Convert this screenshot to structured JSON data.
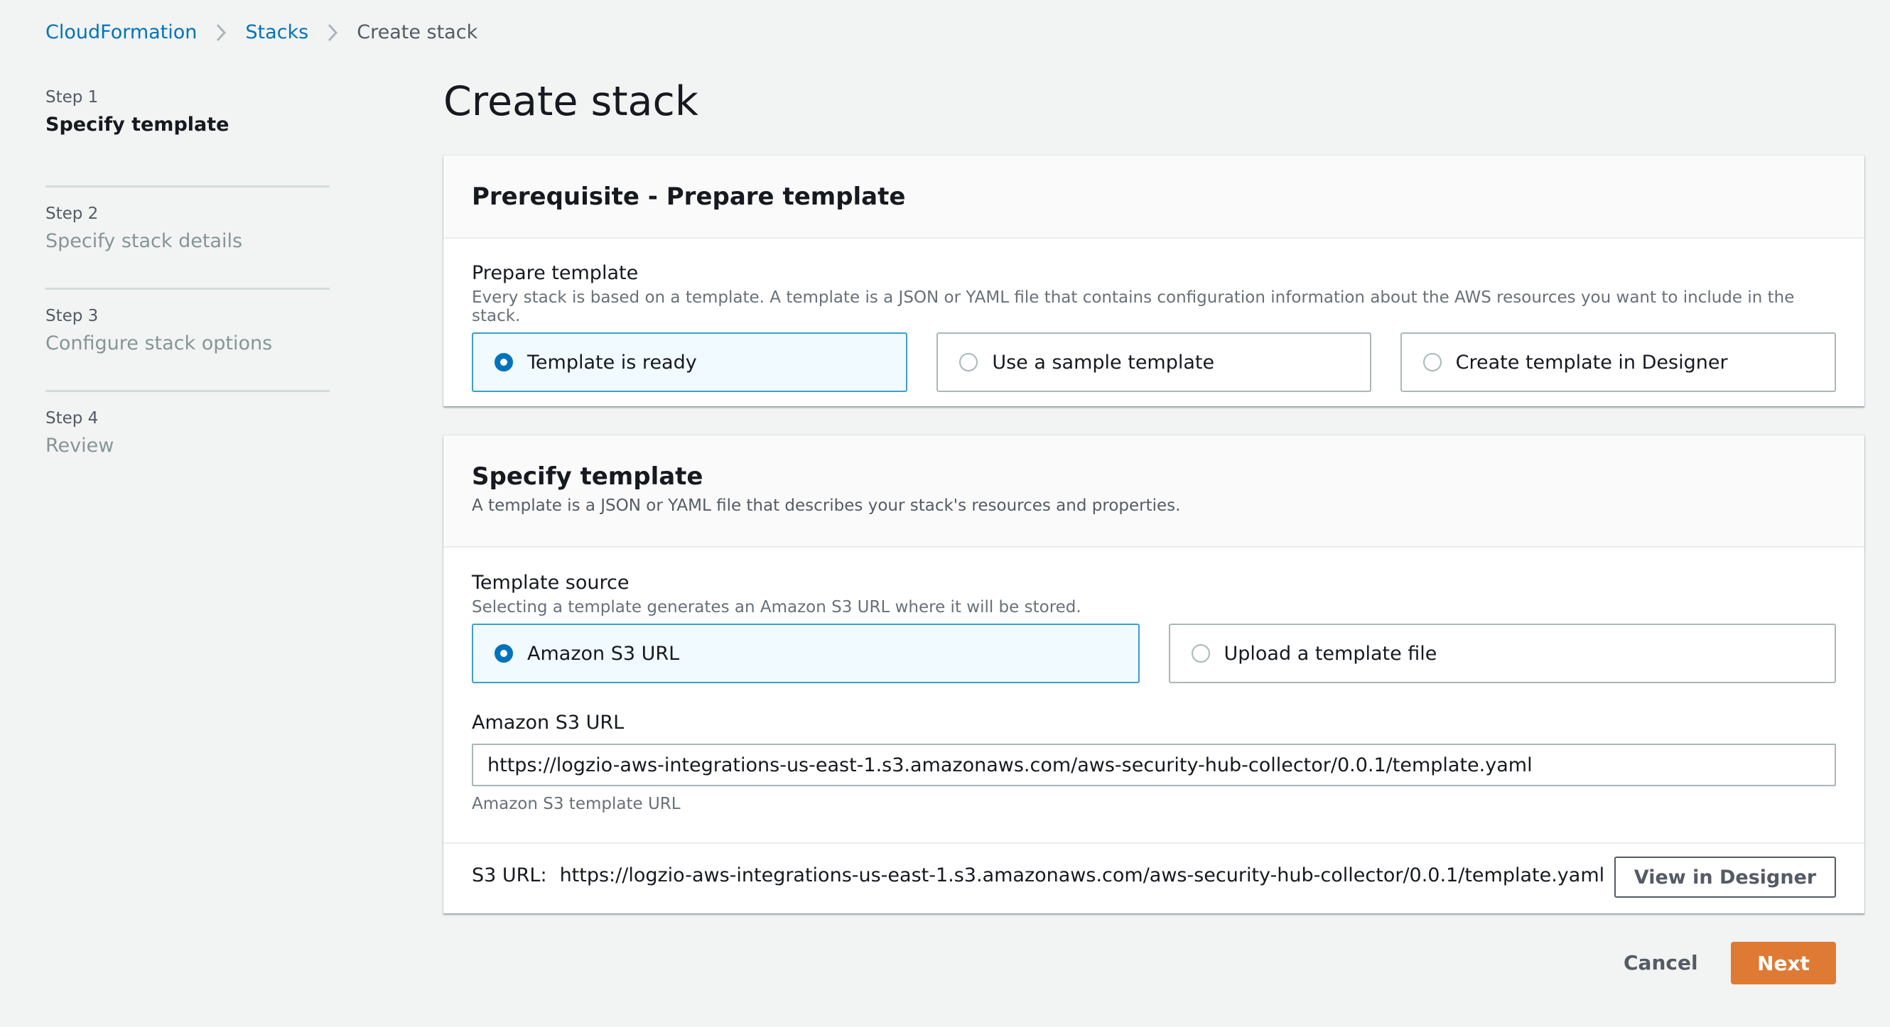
{
  "breadcrumb": {
    "items": [
      "CloudFormation",
      "Stacks",
      "Create stack"
    ]
  },
  "steps": [
    {
      "number": "Step 1",
      "title": "Specify template",
      "active": true
    },
    {
      "number": "Step 2",
      "title": "Specify stack details",
      "active": false
    },
    {
      "number": "Step 3",
      "title": "Configure stack options",
      "active": false
    },
    {
      "number": "Step 4",
      "title": "Review",
      "active": false
    }
  ],
  "page_title": "Create stack",
  "prerequisite": {
    "header": "Prerequisite - Prepare template",
    "field_label": "Prepare template",
    "field_description": "Every stack is based on a template. A template is a JSON or YAML file that contains configuration information about the AWS resources you want to include in the stack.",
    "options": [
      {
        "label": "Template is ready",
        "selected": true
      },
      {
        "label": "Use a sample template",
        "selected": false
      },
      {
        "label": "Create template in Designer",
        "selected": false
      }
    ]
  },
  "specify_template": {
    "header": "Specify template",
    "header_description": "A template is a JSON or YAML file that describes your stack's resources and properties.",
    "source_label": "Template source",
    "source_description": "Selecting a template generates an Amazon S3 URL where it will be stored.",
    "source_options": [
      {
        "label": "Amazon S3 URL",
        "selected": true
      },
      {
        "label": "Upload a template file",
        "selected": false
      }
    ],
    "url_label": "Amazon S3 URL",
    "url_value": "https://logzio-aws-integrations-us-east-1.s3.amazonaws.com/aws-security-hub-collector/0.0.1/template.yaml",
    "url_constraint": "Amazon S3 template URL",
    "footer_label": "S3 URL:",
    "footer_url": "https://logzio-aws-integrations-us-east-1.s3.amazonaws.com/aws-security-hub-collector/0.0.1/template.yaml",
    "view_designer_label": "View in Designer"
  },
  "actions": {
    "cancel_label": "Cancel",
    "next_label": "Next"
  },
  "colors": {
    "link": "#0073bb",
    "primary_button": "#df7a34",
    "selected_tile_border": "#3d9fc7",
    "selected_tile_bg": "#f1faff",
    "background": "#f2f3f3"
  }
}
